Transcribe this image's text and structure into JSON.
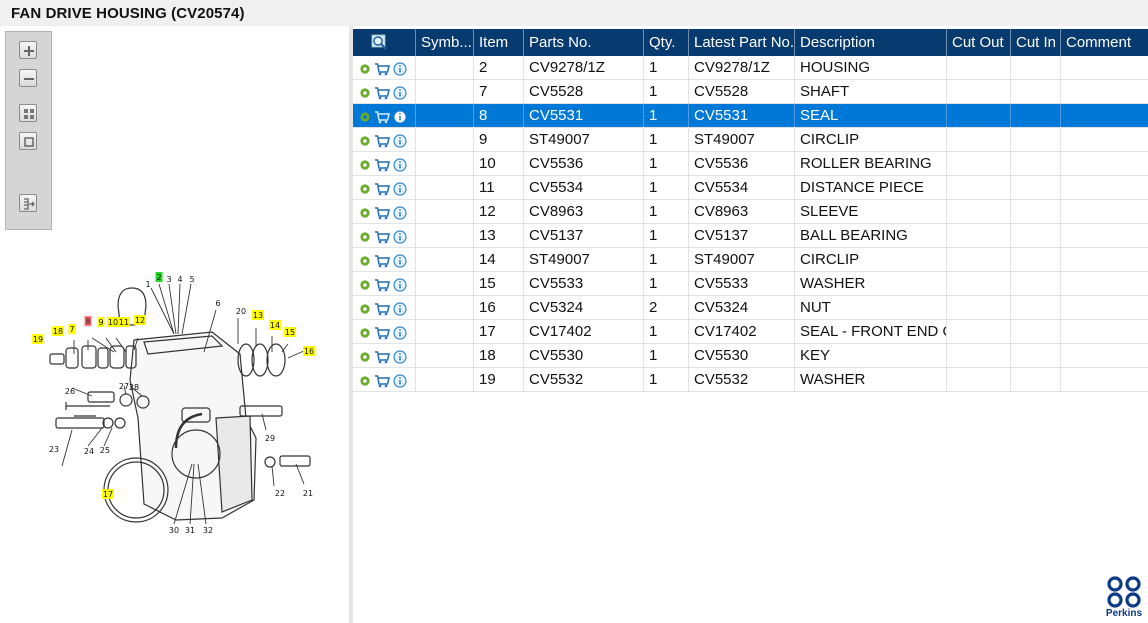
{
  "window": {
    "title": "FAN DRIVE HOUSING (CV20574)"
  },
  "toolbar": {
    "buttons": [
      {
        "name": "zoom-in-button",
        "icon": "zoom-in-icon"
      },
      {
        "name": "zoom-out-button",
        "icon": "zoom-out-icon"
      },
      {
        "name": "fit-all-button",
        "icon": "fit-all-icon"
      },
      {
        "name": "actual-size-button",
        "icon": "actual-size-icon"
      },
      {
        "name": "export-button",
        "icon": "export-icon"
      }
    ]
  },
  "diagram": {
    "callouts": [
      "1",
      "2",
      "3",
      "4",
      "5",
      "6",
      "7",
      "8",
      "9",
      "10",
      "11",
      "12",
      "13",
      "14",
      "15",
      "16",
      "17",
      "18",
      "19",
      "20",
      "21",
      "22",
      "23",
      "24",
      "25",
      "26",
      "27",
      "28",
      "29",
      "30",
      "31",
      "32"
    ],
    "highlight_colors": {
      "yellow": "#ffff00",
      "green": "#22dd22",
      "red": "#ff6f6f"
    }
  },
  "table": {
    "search_icon": "magnifier-icon",
    "columns": [
      "Symb...",
      "Item",
      "Parts No.",
      "Qty.",
      "Latest Part No.",
      "Description",
      "Cut Out",
      "Cut In",
      "Comment"
    ],
    "selected_item": "8",
    "rows": [
      {
        "symb": "",
        "item": "2",
        "parts_no": "CV9278/1Z",
        "qty": "1",
        "latest": "CV9278/1Z",
        "desc": "HOUSING",
        "cut_out": "",
        "cut_in": "",
        "comment": ""
      },
      {
        "symb": "",
        "item": "7",
        "parts_no": "CV5528",
        "qty": "1",
        "latest": "CV5528",
        "desc": "SHAFT",
        "cut_out": "",
        "cut_in": "",
        "comment": ""
      },
      {
        "symb": "",
        "item": "8",
        "parts_no": "CV5531",
        "qty": "1",
        "latest": "CV5531",
        "desc": "SEAL",
        "cut_out": "",
        "cut_in": "",
        "comment": ""
      },
      {
        "symb": "",
        "item": "9",
        "parts_no": "ST49007",
        "qty": "1",
        "latest": "ST49007",
        "desc": "CIRCLIP",
        "cut_out": "",
        "cut_in": "",
        "comment": ""
      },
      {
        "symb": "",
        "item": "10",
        "parts_no": "CV5536",
        "qty": "1",
        "latest": "CV5536",
        "desc": "ROLLER BEARING",
        "cut_out": "",
        "cut_in": "",
        "comment": ""
      },
      {
        "symb": "",
        "item": "11",
        "parts_no": "CV5534",
        "qty": "1",
        "latest": "CV5534",
        "desc": "DISTANCE PIECE",
        "cut_out": "",
        "cut_in": "",
        "comment": ""
      },
      {
        "symb": "",
        "item": "12",
        "parts_no": "CV8963",
        "qty": "1",
        "latest": "CV8963",
        "desc": "SLEEVE",
        "cut_out": "",
        "cut_in": "",
        "comment": ""
      },
      {
        "symb": "",
        "item": "13",
        "parts_no": "CV5137",
        "qty": "1",
        "latest": "CV5137",
        "desc": "BALL BEARING",
        "cut_out": "",
        "cut_in": "",
        "comment": ""
      },
      {
        "symb": "",
        "item": "14",
        "parts_no": "ST49007",
        "qty": "1",
        "latest": "ST49007",
        "desc": "CIRCLIP",
        "cut_out": "",
        "cut_in": "",
        "comment": ""
      },
      {
        "symb": "",
        "item": "15",
        "parts_no": "CV5533",
        "qty": "1",
        "latest": "CV5533",
        "desc": "WASHER",
        "cut_out": "",
        "cut_in": "",
        "comment": ""
      },
      {
        "symb": "",
        "item": "16",
        "parts_no": "CV5324",
        "qty": "2",
        "latest": "CV5324",
        "desc": "NUT",
        "cut_out": "",
        "cut_in": "",
        "comment": ""
      },
      {
        "symb": "",
        "item": "17",
        "parts_no": "CV17402",
        "qty": "1",
        "latest": "CV17402",
        "desc": "SEAL - FRONT END OI",
        "cut_out": "",
        "cut_in": "",
        "comment": ""
      },
      {
        "symb": "",
        "item": "18",
        "parts_no": "CV5530",
        "qty": "1",
        "latest": "CV5530",
        "desc": "KEY",
        "cut_out": "",
        "cut_in": "",
        "comment": ""
      },
      {
        "symb": "",
        "item": "19",
        "parts_no": "CV5532",
        "qty": "1",
        "latest": "CV5532",
        "desc": "WASHER",
        "cut_out": "",
        "cut_in": "",
        "comment": ""
      }
    ],
    "row_icons": [
      "details-icon",
      "cart-icon",
      "info-icon"
    ]
  },
  "brand": {
    "name": "Perkins",
    "color": "#0b3a86"
  },
  "colors": {
    "header_bg": "#073a6e",
    "selection_bg": "#0078d7",
    "cart": "#1f6fbf",
    "info": "#2a86d6"
  }
}
